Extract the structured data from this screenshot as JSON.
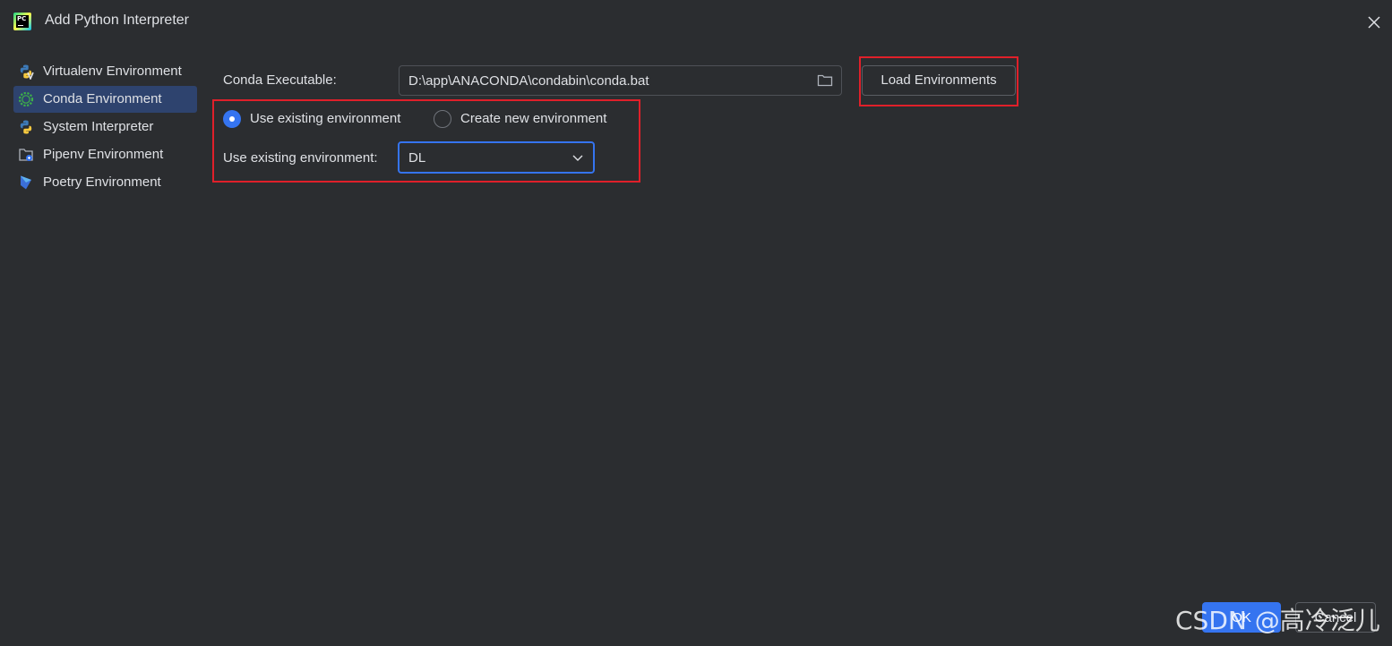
{
  "window": {
    "title": "Add Python Interpreter",
    "app_icon_text": "PC"
  },
  "sidebar": {
    "items": [
      {
        "label": "Virtualenv Environment",
        "icon": "virtualenv-icon",
        "selected": false
      },
      {
        "label": "Conda Environment",
        "icon": "conda-icon",
        "selected": true
      },
      {
        "label": "System Interpreter",
        "icon": "python-icon",
        "selected": false
      },
      {
        "label": "Pipenv Environment",
        "icon": "pipenv-icon",
        "selected": false
      },
      {
        "label": "Poetry Environment",
        "icon": "poetry-icon",
        "selected": false
      }
    ]
  },
  "main": {
    "conda_executable_label": "Conda Executable:",
    "conda_executable_value": "D:\\app\\ANACONDA\\condabin\\conda.bat",
    "load_button_label": "Load Environments",
    "radio_existing_label": "Use existing environment",
    "radio_new_label": "Create new environment",
    "radio_selected": "existing",
    "existing_env_label": "Use existing environment:",
    "existing_env_value": "DL"
  },
  "footer": {
    "ok_label": "OK",
    "cancel_label": "Cancel"
  },
  "watermark": "CSDN @高冷泛儿",
  "colors": {
    "background": "#2b2d30",
    "selected_item": "#2e436e",
    "accent": "#3574f0",
    "highlight_box": "#e0202a",
    "text": "#dfe1e5"
  }
}
